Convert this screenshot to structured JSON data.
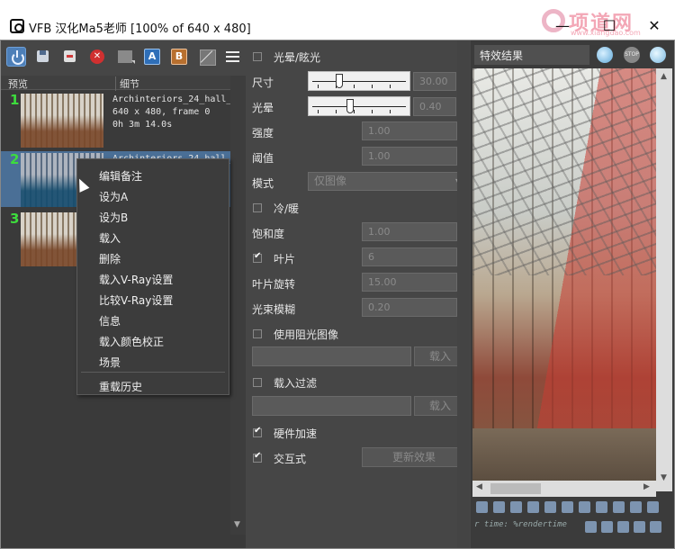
{
  "window": {
    "title": "VFB 汉化Ma5老师 [100% of 640 x 480]",
    "minimize": "—",
    "maximize": "☐",
    "close": "✕"
  },
  "watermark": {
    "text": "项道网",
    "url": "www.xiangdao.com"
  },
  "toolbar": {
    "icons": [
      "power-icon",
      "save-icon",
      "load-icon",
      "clear-icon",
      "channel-icon",
      "a-icon",
      "b-icon",
      "compare-icon",
      "menu-icon"
    ],
    "a_label": "A",
    "b_label": "B"
  },
  "history": {
    "col_preview": "预览",
    "col_details": "细节",
    "items": [
      {
        "num": "1",
        "info": "Archinteriors_24_hall_\n640 x 480, frame 0\n0h 3m 14.0s"
      },
      {
        "num": "2",
        "info": "Archinteriors_24_hall_"
      },
      {
        "num": "3",
        "info": ""
      }
    ]
  },
  "context_menu": {
    "items": [
      "编辑备注",
      "设为A",
      "设为B",
      "载入",
      "删除",
      "载入V-Ray设置",
      "比较V-Ray设置",
      "信息",
      "载入颜色校正",
      "场景",
      "重载历史"
    ]
  },
  "settings": {
    "glare_label": "光晕/眩光",
    "size_label": "尺寸",
    "size_value": "30.00",
    "bloom_label": "光晕",
    "bloom_value": "0.40",
    "intensity_label": "强度",
    "intensity_value": "1.00",
    "threshold_label": "阈值",
    "threshold_value": "1.00",
    "mode_label": "模式",
    "mode_value": "仅图像",
    "cold_warm_label": "冷/暖",
    "saturation_label": "饱和度",
    "saturation_value": "1.00",
    "blades_label": "叶片",
    "blades_value": "6",
    "blade_rotation_label": "叶片旋转",
    "blade_rotation_value": "15.00",
    "beam_blur_label": "光束模糊",
    "beam_blur_value": "0.20",
    "use_obstacle_label": "使用阻光图像",
    "load_button_1": "载入",
    "load_filter_label": "载入过滤",
    "load_button_2": "载入",
    "hw_accel_label": "硬件加速",
    "interactive_label": "交互式",
    "update_button": "更新效果"
  },
  "preview": {
    "title": "特效结果",
    "stop_label": "STOP",
    "status_text": "r time: %rendertime"
  }
}
